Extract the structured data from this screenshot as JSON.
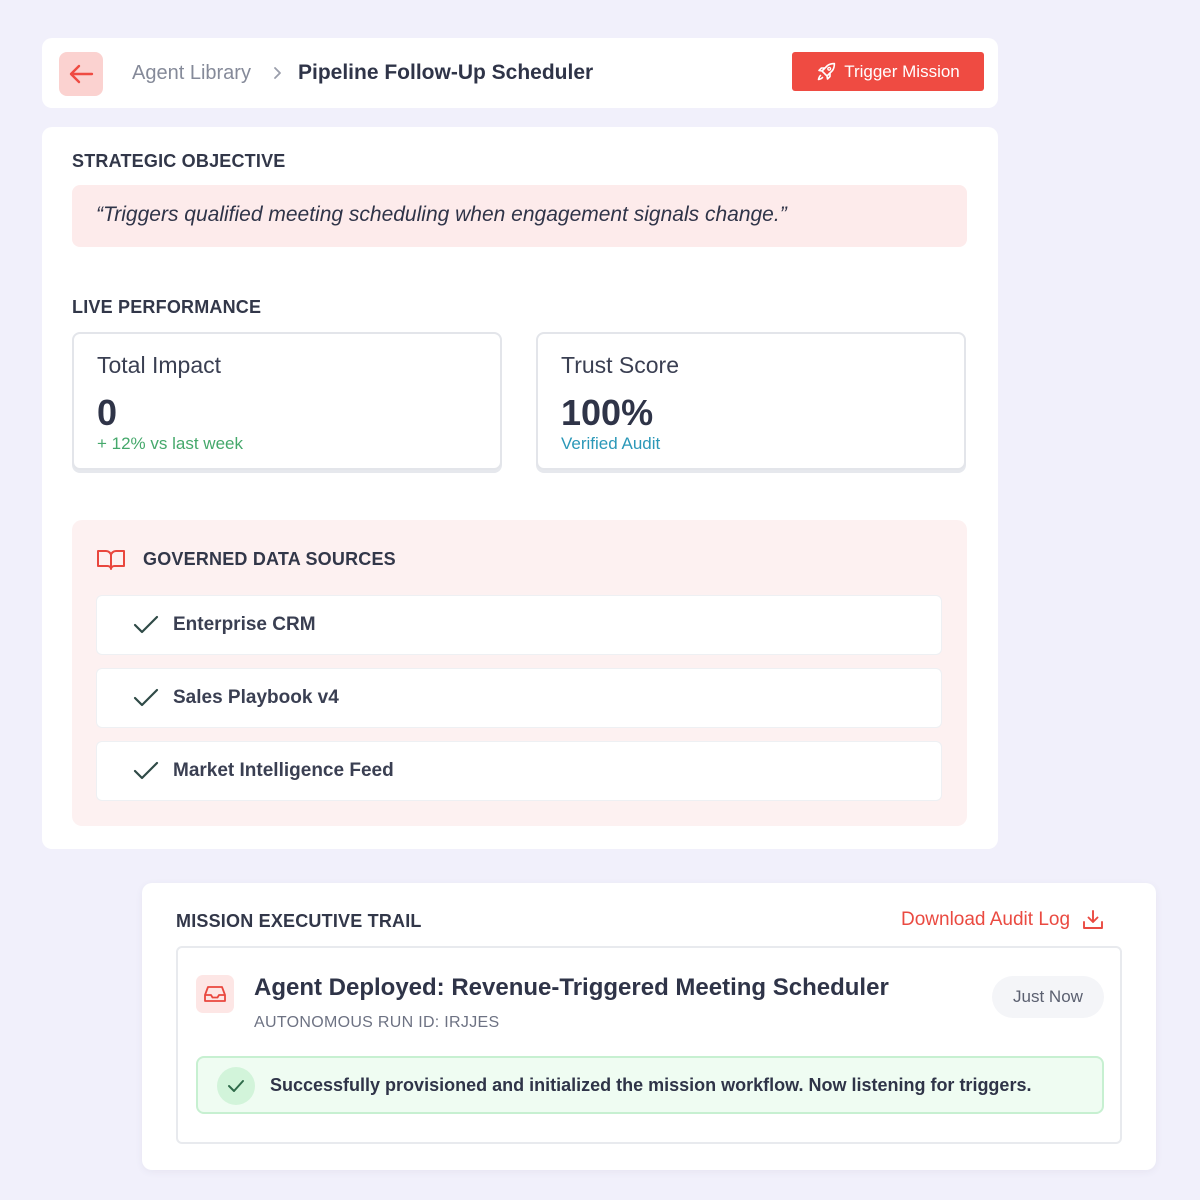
{
  "header": {
    "back_icon": "arrow-left-icon",
    "breadcrumb_parent": "Agent Library",
    "breadcrumb_separator_icon": "chevron-right-icon",
    "breadcrumb_current": "Pipeline Follow-Up Scheduler",
    "trigger_icon": "rocket-icon",
    "trigger_label": "Trigger Mission"
  },
  "objective": {
    "title": "STRATEGIC OBJECTIVE",
    "text": "“Triggers qualified meeting scheduling when engagement signals change.”"
  },
  "performance": {
    "title": "LIVE PERFORMANCE",
    "metrics": [
      {
        "label": "Total Impact",
        "value": "0",
        "sub": "+ 12% vs last week",
        "sub_color": "#45a86b"
      },
      {
        "label": "Trust Score",
        "value": "100%",
        "sub": "Verified Audit",
        "sub_color": "#2b98b8"
      }
    ]
  },
  "sources": {
    "icon": "book-open-icon",
    "title": "GOVERNED DATA SOURCES",
    "items": [
      {
        "label": "Enterprise CRM",
        "icon": "check-icon"
      },
      {
        "label": "Sales Playbook v4",
        "icon": "check-icon"
      },
      {
        "label": "Market Intelligence Feed",
        "icon": "check-icon"
      }
    ]
  },
  "trail": {
    "title": "MISSION EXECUTIVE TRAIL",
    "download_label": "Download Audit Log",
    "download_icon": "download-icon",
    "event": {
      "icon": "inbox-icon",
      "title": "Agent Deployed: Revenue-Triggered Meeting Scheduler",
      "run_id": "AUTONOMOUS RUN ID: IRJJES",
      "time": "Just Now",
      "success_icon": "check-icon",
      "success_text": "Successfully provisioned and initialized the mission workflow. Now listening for triggers."
    }
  },
  "colors": {
    "accent": "#ef4b42",
    "background": "#f1f0fb",
    "success_green": "#45a86b",
    "info_blue": "#2b98b8"
  }
}
